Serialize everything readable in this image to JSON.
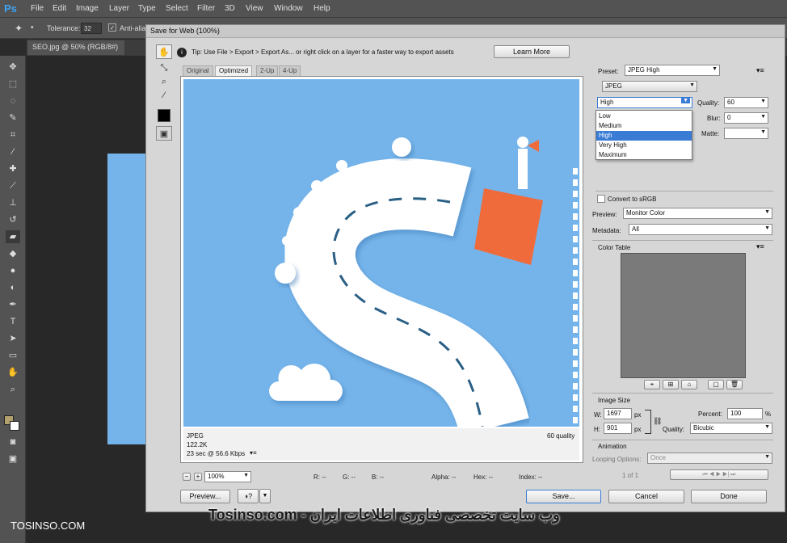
{
  "menubar": {
    "items": [
      "File",
      "Edit",
      "Image",
      "Layer",
      "Type",
      "Select",
      "Filter",
      "3D",
      "View",
      "Window",
      "Help"
    ]
  },
  "optionsbar": {
    "tolerance_label": "Tolerance:",
    "tolerance_value": "32",
    "antialias_label": "Anti-alias"
  },
  "doc_tab": {
    "title": "SEO.jpg @ 50% (RGB/8#)"
  },
  "dialog": {
    "title": "Save for Web (100%)",
    "tip": "Tip: Use File > Export > Export As...  or right click on a layer for a faster way to export assets",
    "learn_more": "Learn More",
    "view_tabs": [
      "Original",
      "Optimized",
      "2-Up",
      "4-Up"
    ],
    "active_tab": "Optimized",
    "info": {
      "format": "JPEG",
      "size": "122.2K",
      "time": "23 sec @ 56.6 Kbps",
      "quality": "60 quality"
    },
    "zoom": "100%",
    "readouts": {
      "r": "R: --",
      "g": "G: --",
      "b": "B: --",
      "alpha": "Alpha: --",
      "hex": "Hex: --",
      "index": "Index: --"
    },
    "buttons": {
      "preview": "Preview...",
      "save": "Save...",
      "cancel": "Cancel",
      "done": "Done"
    }
  },
  "settings": {
    "preset_label": "Preset:",
    "preset_value": "JPEG High",
    "format_value": "JPEG",
    "quality_mode": "High",
    "quality_label": "Quality:",
    "quality_value": "60",
    "blur_label": "Blur:",
    "blur_value": "0",
    "matte_label": "Matte:",
    "dropdown_options": [
      "Low",
      "Medium",
      "High",
      "Very High",
      "Maximum"
    ],
    "dropdown_selected": "High",
    "convert_srgb": "Convert to sRGB",
    "preview_label": "Preview:",
    "preview_value": "Monitor Color",
    "metadata_label": "Metadata:",
    "metadata_value": "All",
    "color_table_label": "Color Table",
    "image_size_label": "Image Size",
    "w_label": "W:",
    "w_value": "1697",
    "h_label": "H:",
    "h_value": "901",
    "px": "px",
    "percent_label": "Percent:",
    "percent_value": "100",
    "percent_sign": "%",
    "resample_label": "Quality:",
    "resample_value": "Bicubic",
    "animation_label": "Animation",
    "looping_label": "Looping Options:",
    "looping_value": "Once",
    "frame_counter": "1 of 1"
  },
  "watermark": {
    "left": "TOSINSO.COM",
    "center": "Tosinso.com - وب سایت تخصصی فناوری اطلاعات ایران"
  },
  "colors": {
    "accent": "#3a7bd5",
    "sky": "#75b4ea",
    "flag": "#ef6b3b"
  }
}
